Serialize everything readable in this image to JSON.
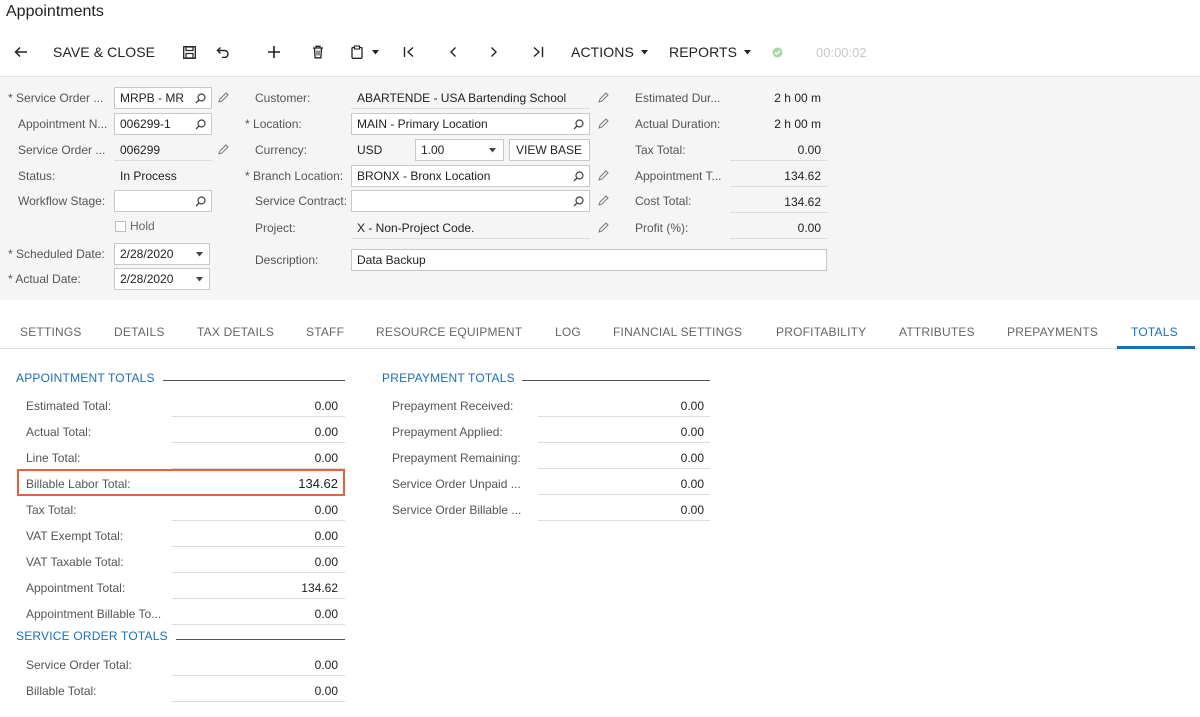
{
  "page_title": "Appointments",
  "toolbar": {
    "save_close": "SAVE & CLOSE",
    "actions": "ACTIONS",
    "reports": "REPORTS",
    "timer": "00:00:02"
  },
  "summary": {
    "service_order_type": {
      "label": "Service Order ...",
      "value": "MRPB - MR"
    },
    "appointment_nbr": {
      "label": "Appointment N...",
      "value": "006299-1"
    },
    "service_order_nbr": {
      "label": "Service Order ...",
      "value": "006299"
    },
    "status": {
      "label": "Status:",
      "value": "In Process"
    },
    "workflow_stage": {
      "label": "Workflow Stage:",
      "value": ""
    },
    "hold": {
      "label": "Hold"
    },
    "scheduled_date": {
      "label": "Scheduled Date:",
      "value": "2/28/2020"
    },
    "actual_date": {
      "label": "Actual Date:",
      "value": "2/28/2020"
    },
    "customer": {
      "label": "Customer:",
      "value": "ABARTENDE - USA Bartending School"
    },
    "location": {
      "label": "Location:",
      "value": "MAIN - Primary Location"
    },
    "currency": {
      "label": "Currency:",
      "value": "USD",
      "rate": "1.00",
      "view_base": "VIEW BASE"
    },
    "branch_location": {
      "label": "Branch Location:",
      "value": "BRONX - Bronx Location"
    },
    "service_contract": {
      "label": "Service Contract:",
      "value": ""
    },
    "project": {
      "label": "Project:",
      "value": "X - Non-Project Code."
    },
    "description": {
      "label": "Description:",
      "value": "Data Backup"
    },
    "estimated_duration": {
      "label": "Estimated Dur...",
      "value": "2 h 00 m"
    },
    "actual_duration": {
      "label": "Actual Duration:",
      "value": "2 h 00 m"
    },
    "tax_total": {
      "label": "Tax Total:",
      "value": "0.00"
    },
    "appointment_total": {
      "label": "Appointment T...",
      "value": "134.62"
    },
    "cost_total": {
      "label": "Cost Total:",
      "value": "134.62"
    },
    "profit": {
      "label": "Profit (%):",
      "value": "0.00"
    }
  },
  "tabs": [
    "SETTINGS",
    "DETAILS",
    "TAX DETAILS",
    "STAFF",
    "RESOURCE EQUIPMENT",
    "LOG",
    "FINANCIAL SETTINGS",
    "PROFITABILITY",
    "ATTRIBUTES",
    "PREPAYMENTS",
    "TOTALS"
  ],
  "active_tab": "TOTALS",
  "appointment_totals": {
    "title": "APPOINTMENT TOTALS",
    "rows": [
      {
        "label": "Estimated Total:",
        "value": "0.00"
      },
      {
        "label": "Actual Total:",
        "value": "0.00"
      },
      {
        "label": "Line Total:",
        "value": "0.00"
      },
      {
        "label": "Billable Labor Total:",
        "value": "134.62"
      },
      {
        "label": "Tax Total:",
        "value": "0.00"
      },
      {
        "label": "VAT Exempt Total:",
        "value": "0.00"
      },
      {
        "label": "VAT Taxable Total:",
        "value": "0.00"
      },
      {
        "label": "Appointment Total:",
        "value": "134.62"
      },
      {
        "label": "Appointment Billable To...",
        "value": "0.00"
      }
    ]
  },
  "service_order_totals": {
    "title": "SERVICE ORDER TOTALS",
    "rows": [
      {
        "label": "Service Order Total:",
        "value": "0.00"
      },
      {
        "label": "Billable Total:",
        "value": "0.00"
      }
    ]
  },
  "prepayment_totals": {
    "title": "PREPAYMENT TOTALS",
    "rows": [
      {
        "label": "Prepayment Received:",
        "value": "0.00"
      },
      {
        "label": "Prepayment Applied:",
        "value": "0.00"
      },
      {
        "label": "Prepayment Remaining:",
        "value": "0.00"
      },
      {
        "label": "Service Order Unpaid ...",
        "value": "0.00"
      },
      {
        "label": "Service Order Billable ...",
        "value": "0.00"
      }
    ]
  },
  "colors": {
    "accent": "#1a6fb5",
    "highlight": "#e8603c",
    "success": "#5cb85c"
  }
}
